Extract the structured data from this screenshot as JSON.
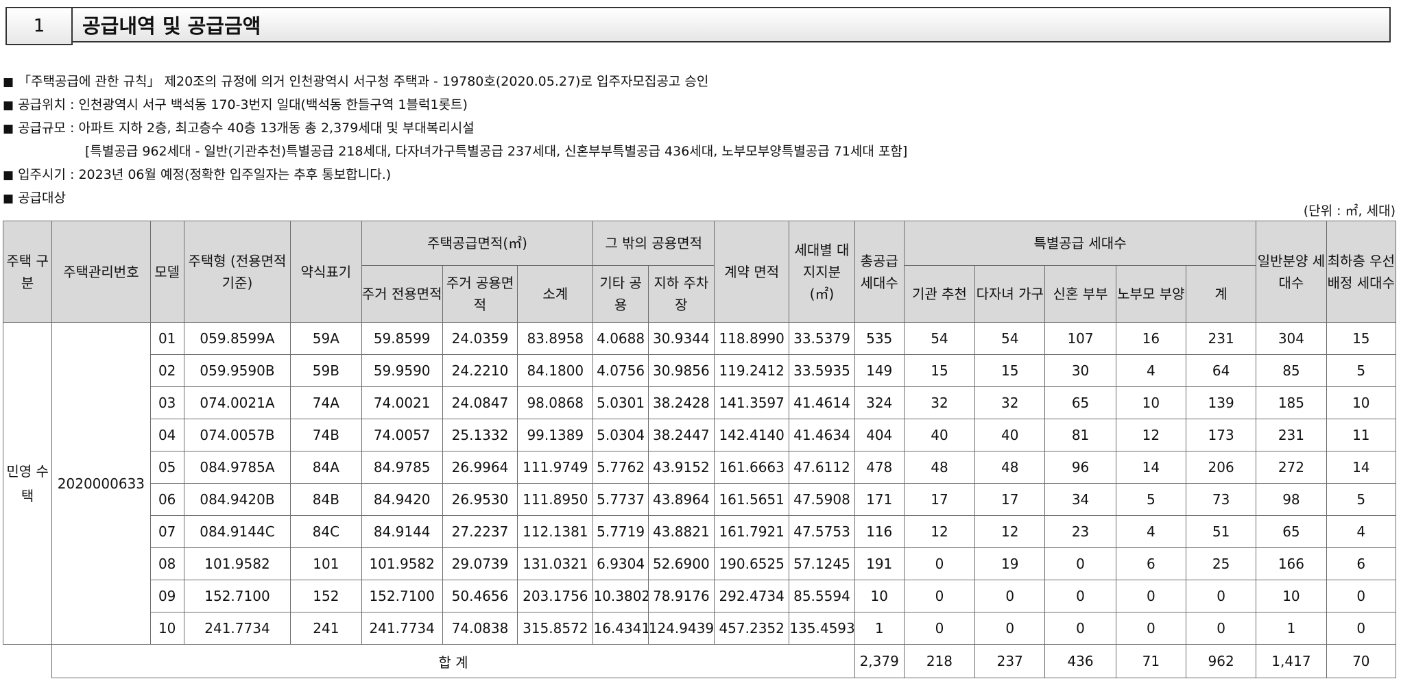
{
  "section": {
    "number": "1",
    "title": "공급내역 및 공급금액"
  },
  "notes": [
    {
      "bullet": "■",
      "text": "「주택공급에 관한 규칙」 제20조의 규정에 의거 인천광역시 서구청 주택과 - 19780호(2020.05.27)로 입주자모집공고 승인"
    },
    {
      "bullet": "■",
      "text": "공급위치 : 인천광역시 서구 백석동 170-3번지 일대(백석동 한들구역 1블럭1롯트)"
    },
    {
      "bullet": "■",
      "text": "공급규모 : 아파트 지하 2층, 최고층수 40층 13개동 총 2,379세대 및 부대복리시설"
    },
    {
      "bullet": "",
      "text": "[특별공급 962세대 - 일반(기관추천)특별공급 218세대, 다자녀가구특별공급 237세대, 신혼부부특별공급 436세대, 노부모부양특별공급 71세대 포함]"
    },
    {
      "bullet": "■",
      "text": "입주시기 : 2023년 06월 예정(정확한 입주일자는 추후 통보합니다.)"
    },
    {
      "bullet": "■",
      "text": "공급대상"
    }
  ],
  "unit": "(단위 : ㎡, 세대)",
  "headers": {
    "housing_type": "주택 구분",
    "mgmt_no": "주택관리번호",
    "model": "모델",
    "house_type": "주택형 (전용면적기준)",
    "short": "약식표기",
    "supply_area": "주택공급면적(㎡)",
    "res_exclusive": "주거 전용면적",
    "res_common": "주거 공용면적",
    "subtotal": "소계",
    "other_common": "그 밖의 공용면적",
    "etc_common": "기타 공용",
    "basement_parking": "지하 주차장",
    "contract_area": "계약 면적",
    "land_share": "세대별 대지지분 (㎡)",
    "total_units": "총공급 세대수",
    "special": "특별공급 세대수",
    "institution": "기관 추천",
    "multichild": "다자녀 가구",
    "newlywed": "신혼 부부",
    "elderly": "노부모 부양",
    "special_sum": "계",
    "general": "일반분양 세대수",
    "low_floor": "최하층 우선배정 세대수"
  },
  "housing_category": "민영 수택",
  "management_number": "2020000633",
  "rows": [
    {
      "model": "01",
      "type": "059.8599A",
      "short": "59A",
      "excl": "59.8599",
      "common": "24.0359",
      "sub": "83.8958",
      "etc": "4.0688",
      "park": "30.9344",
      "contract": "118.8990",
      "land": "33.5379",
      "total": "535",
      "inst": "54",
      "multi": "54",
      "newly": "107",
      "elder": "16",
      "sp_sum": "231",
      "general": "304",
      "low": "15"
    },
    {
      "model": "02",
      "type": "059.9590B",
      "short": "59B",
      "excl": "59.9590",
      "common": "24.2210",
      "sub": "84.1800",
      "etc": "4.0756",
      "park": "30.9856",
      "contract": "119.2412",
      "land": "33.5935",
      "total": "149",
      "inst": "15",
      "multi": "15",
      "newly": "30",
      "elder": "4",
      "sp_sum": "64",
      "general": "85",
      "low": "5"
    },
    {
      "model": "03",
      "type": "074.0021A",
      "short": "74A",
      "excl": "74.0021",
      "common": "24.0847",
      "sub": "98.0868",
      "etc": "5.0301",
      "park": "38.2428",
      "contract": "141.3597",
      "land": "41.4614",
      "total": "324",
      "inst": "32",
      "multi": "32",
      "newly": "65",
      "elder": "10",
      "sp_sum": "139",
      "general": "185",
      "low": "10"
    },
    {
      "model": "04",
      "type": "074.0057B",
      "short": "74B",
      "excl": "74.0057",
      "common": "25.1332",
      "sub": "99.1389",
      "etc": "5.0304",
      "park": "38.2447",
      "contract": "142.4140",
      "land": "41.4634",
      "total": "404",
      "inst": "40",
      "multi": "40",
      "newly": "81",
      "elder": "12",
      "sp_sum": "173",
      "general": "231",
      "low": "11"
    },
    {
      "model": "05",
      "type": "084.9785A",
      "short": "84A",
      "excl": "84.9785",
      "common": "26.9964",
      "sub": "111.9749",
      "etc": "5.7762",
      "park": "43.9152",
      "contract": "161.6663",
      "land": "47.6112",
      "total": "478",
      "inst": "48",
      "multi": "48",
      "newly": "96",
      "elder": "14",
      "sp_sum": "206",
      "general": "272",
      "low": "14"
    },
    {
      "model": "06",
      "type": "084.9420B",
      "short": "84B",
      "excl": "84.9420",
      "common": "26.9530",
      "sub": "111.8950",
      "etc": "5.7737",
      "park": "43.8964",
      "contract": "161.5651",
      "land": "47.5908",
      "total": "171",
      "inst": "17",
      "multi": "17",
      "newly": "34",
      "elder": "5",
      "sp_sum": "73",
      "general": "98",
      "low": "5"
    },
    {
      "model": "07",
      "type": "084.9144C",
      "short": "84C",
      "excl": "84.9144",
      "common": "27.2237",
      "sub": "112.1381",
      "etc": "5.7719",
      "park": "43.8821",
      "contract": "161.7921",
      "land": "47.5753",
      "total": "116",
      "inst": "12",
      "multi": "12",
      "newly": "23",
      "elder": "4",
      "sp_sum": "51",
      "general": "65",
      "low": "4"
    },
    {
      "model": "08",
      "type": "101.9582",
      "short": "101",
      "excl": "101.9582",
      "common": "29.0739",
      "sub": "131.0321",
      "etc": "6.9304",
      "park": "52.6900",
      "contract": "190.6525",
      "land": "57.1245",
      "total": "191",
      "inst": "0",
      "multi": "19",
      "newly": "0",
      "elder": "6",
      "sp_sum": "25",
      "general": "166",
      "low": "6"
    },
    {
      "model": "09",
      "type": "152.7100",
      "short": "152",
      "excl": "152.7100",
      "common": "50.4656",
      "sub": "203.1756",
      "etc": "10.3802",
      "park": "78.9176",
      "contract": "292.4734",
      "land": "85.5594",
      "total": "10",
      "inst": "0",
      "multi": "0",
      "newly": "0",
      "elder": "0",
      "sp_sum": "0",
      "general": "10",
      "low": "0"
    },
    {
      "model": "10",
      "type": "241.7734",
      "short": "241",
      "excl": "241.7734",
      "common": "74.0838",
      "sub": "315.8572",
      "etc": "16.4341",
      "park": "124.9439",
      "contract": "457.2352",
      "land": "135.4593",
      "total": "1",
      "inst": "0",
      "multi": "0",
      "newly": "0",
      "elder": "0",
      "sp_sum": "0",
      "general": "1",
      "low": "0"
    }
  ],
  "totals": {
    "label": "합 계",
    "total": "2,379",
    "inst": "218",
    "multi": "237",
    "newly": "436",
    "elder": "71",
    "sp_sum": "962",
    "general": "1,417",
    "low": "70"
  }
}
